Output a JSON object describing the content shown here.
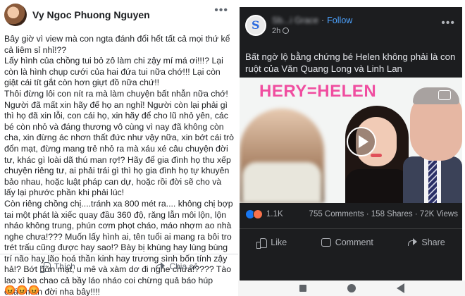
{
  "left_post": {
    "author": "Vy Ngoc Phuong Nguyen",
    "body": "Bây giờ vì view mà con ngta đánh đổi hết tất cả mọi thứ kể cả liêm sỉ nhỉ!??\nLấy hình của chồng tui bỏ zô làm chi zậy mí má ơi!!!? Lại còn là hình chụp cưới của hai đứa tui nữa chớ!!! Lại còn giật cái tít gắt còn hơn giựt đồ nữa chứ!!\nThôi đừng lôi con nít ra mà làm chuyện bất nhẫn nữa chớ! Người đã mất xin hãy để họ an nghỉ! Người còn lại phải gì thì họ đã xin lỗi, con cái họ, xin hãy để cho lũ nhỏ yên, các bé còn nhỏ và đáng thương vô cùng vì nay đã không còn cha, xin đừng ác nhơn thất đức như vậy nữa, xin bớt cái trò đổn mạt, đừng mang trẻ nhỏ ra mà xáu xé câu chuyện đời tư, khác gì loài dã thú man rợ!? Hãy để gia đình họ thu xếp chuyện riêng tư, ai phải trái gì thì họ gia đình họ tự khuyên bảo nhau, hoặc luật pháp can dự, hoặc rồi đời sẽ cho và lấy lại phước phần khi phải lúc!\nCòn riêng chồng chị....tránh xa 800 mét ra.... không chị bợp tai một phát là xiếc quay đầu 360 độ, răng lẫn môi lộn, lộn nháo không trung, phún cơm phọt cháo, máo nhợm ao nhà nghe chưa!??? Muốn lấy hình ai, tên tuổi ai mang ra bôi tro trét trấu cũng được hay sao!? Bày bị khùng hay lùng bùng trí não hay lão hoá thần kinh hay trương sình bốn tính zậy hả!? Bớt đỡn mạt, u mê và xàm dơ đi nghe chưa!???? Tào lao xì ba chao cả bầy láo nháo coi chừng quả báo húp cháo mẫn đời nha bây!!!!",
    "emojis": "😡😡😡",
    "actions": {
      "like": "Thích",
      "share": "Chia sẻ"
    },
    "menu": "•••"
  },
  "right_post": {
    "page_name": "Sb...i Grace",
    "follow": "Follow",
    "separator": "·",
    "time": "2h",
    "menu": "•••",
    "caption": "Bất ngờ lộ bằng chứng bé Helen không phải là con ruột của Văn Quang Long và Linh Lan",
    "image_banner": "HERY=HELEN",
    "reaction_count": "1.1K",
    "comments": "755 Comments",
    "shares": "158 Shares",
    "views": "72K Views",
    "stats_sep": "·",
    "actions": {
      "like": "Like",
      "comment": "Comment",
      "share": "Share"
    }
  },
  "colors": {
    "phone_bg": "#1c1d1f",
    "follow_blue": "#4da3ff",
    "banner_pink": "#f04ea0",
    "like_blue": "#1877f2"
  }
}
